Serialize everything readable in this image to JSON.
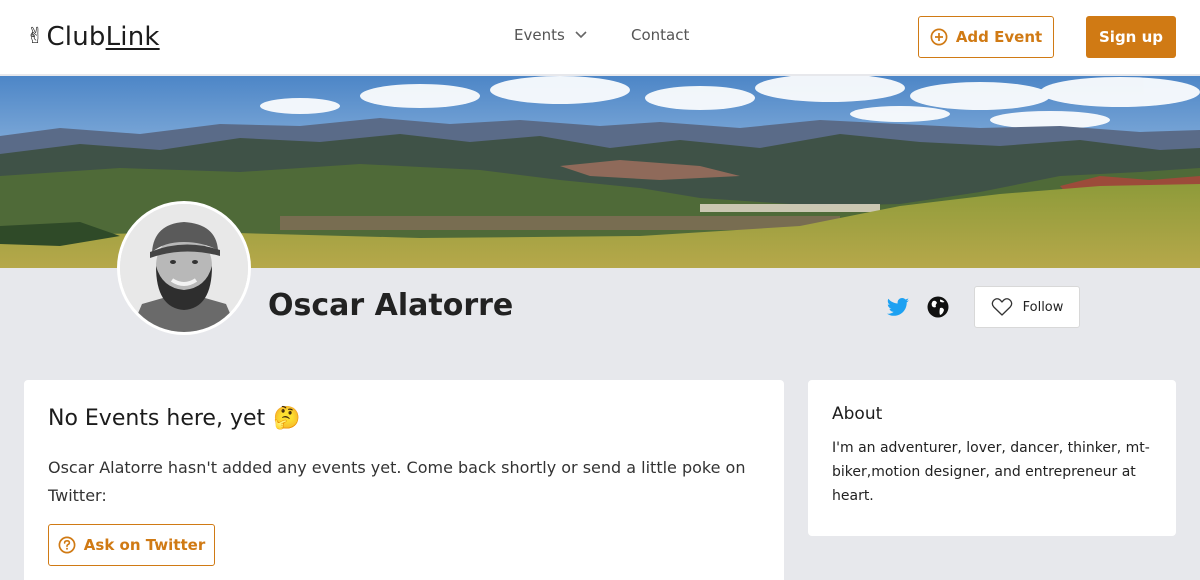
{
  "header": {
    "logo_hand": "✌",
    "logo_club": "Club",
    "logo_link": "Link",
    "nav_events": "Events",
    "nav_contact": "Contact",
    "add_event_label": "Add Event",
    "signup_label": "Sign up"
  },
  "profile": {
    "name": "Oscar Alatorre",
    "follow_label": "Follow"
  },
  "events_card": {
    "heading": "No Events here, yet",
    "heading_emoji": "🤔",
    "message": "Oscar Alatorre hasn't added any events yet. Come back shortly or send a little poke on Twitter:",
    "ask_label": "Ask on Twitter"
  },
  "about_card": {
    "heading": "About",
    "bio": "I'm an adventurer, lover, dancer, thinker, mt-biker,motion designer, and entrepreneur at heart."
  },
  "colors": {
    "accent": "#d07a14",
    "twitter": "#1da1f2",
    "page_bg": "#e7e8ec"
  }
}
